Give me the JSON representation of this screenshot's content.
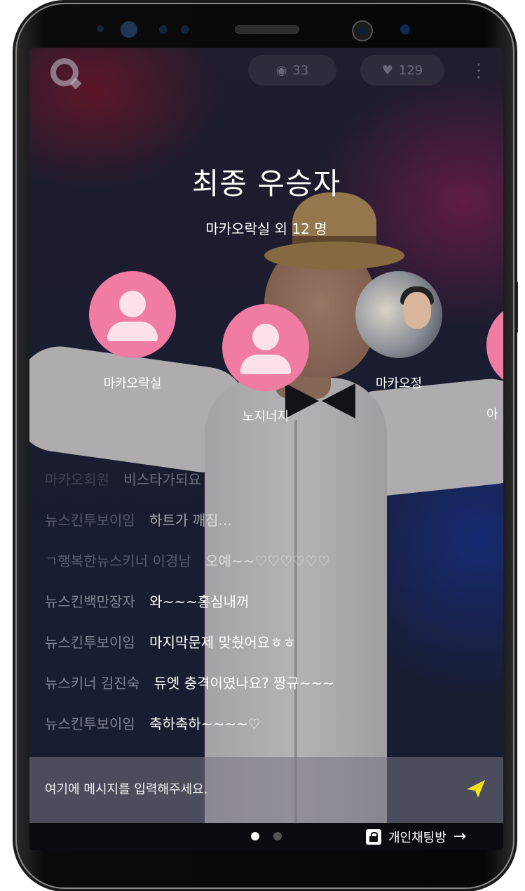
{
  "status": {
    "views": "33",
    "hearts": "129"
  },
  "icons": {
    "logo": "q-logo-icon",
    "views": "eye-icon",
    "hearts": "heart-icon",
    "more": "more-vertical-icon",
    "send": "send-paper-plane-icon",
    "lock": "lock-icon",
    "arrow": "arrow-right-icon"
  },
  "winners": {
    "title": "최종 우승자",
    "subtitle": "마카오락실 외 12 명",
    "items": [
      {
        "name": "마카오락실"
      },
      {
        "name": "노지너지"
      },
      {
        "name": "마카오정"
      },
      {
        "name": "아"
      }
    ]
  },
  "chat": {
    "messages": [
      {
        "user": "마카오회원",
        "text": "비스타가되요"
      },
      {
        "user": "뉴스킨투보이임",
        "text": "하트가 깨짐..."
      },
      {
        "user": "ㄱ행복한뉴스키너 이경남",
        "text": "오예~~♡♡♡♡♡♡"
      },
      {
        "user": "뉴스킨백만장자",
        "text": "와~~~홍심내꺼"
      },
      {
        "user": "뉴스킨투보이임",
        "text": "마지막문제 맞췄어요ㅎㅎ"
      },
      {
        "user": "뉴스키너 김진숙",
        "text": "듀엣 충격이였나요? 짱규~~~"
      },
      {
        "user": "뉴스킨투보이임",
        "text": "축하축하~~~~♡"
      }
    ]
  },
  "input": {
    "placeholder": "여기에 메시지를 입력해주세요."
  },
  "bottom": {
    "private_chat": "개인채팅방",
    "arrow": "→"
  },
  "colors": {
    "avatar_pink": "#f07ba3",
    "send_yellow": "#f5e51b"
  }
}
